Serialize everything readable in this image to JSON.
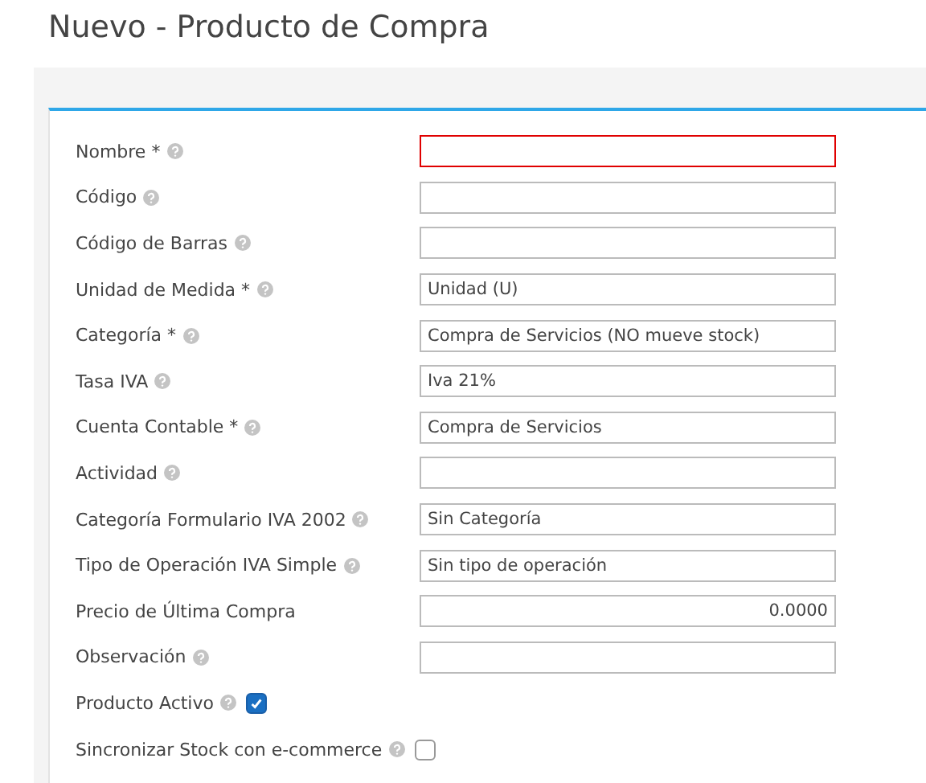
{
  "title": "Nuevo - Producto de Compra",
  "fields": [
    {
      "label": "Nombre *",
      "help": true,
      "kind": "text",
      "invalid": true
    },
    {
      "label": "Código",
      "help": true,
      "kind": "text",
      "invalid": false
    },
    {
      "label": "Código de Barras",
      "help": true,
      "kind": "text",
      "invalid": false
    },
    {
      "label": "Unidad de Medida *",
      "help": true,
      "kind": "select",
      "value": "Unidad (U)",
      "invalid": false
    },
    {
      "label": "Categoría *",
      "help": true,
      "kind": "select",
      "value": "Compra de Servicios (NO mueve stock)",
      "invalid": false
    },
    {
      "label": "Tasa IVA",
      "help": true,
      "kind": "select",
      "value": "Iva 21%",
      "invalid": false
    },
    {
      "label": "Cuenta Contable *",
      "help": true,
      "kind": "select",
      "value": "Compra de Servicios",
      "invalid": false
    },
    {
      "label": "Actividad",
      "help": true,
      "kind": "select",
      "invalid": false
    },
    {
      "label": "Categoría Formulario IVA 2002",
      "help": true,
      "kind": "select",
      "value": "Sin Categoría",
      "invalid": false
    },
    {
      "label": "Tipo de Operación IVA Simple",
      "help": true,
      "kind": "select",
      "value": "Sin tipo de operación",
      "invalid": false
    },
    {
      "label": "Precio de Última Compra",
      "help": false,
      "kind": "number",
      "value": "0.0000",
      "invalid": false
    },
    {
      "label": "Observación",
      "help": true,
      "kind": "text",
      "invalid": false
    },
    {
      "label": "Producto Activo",
      "help": true,
      "kind": "checkbox",
      "checked": true
    },
    {
      "label": "Sincronizar Stock con e-commerce",
      "help": true,
      "kind": "checkbox",
      "checked": false
    }
  ]
}
